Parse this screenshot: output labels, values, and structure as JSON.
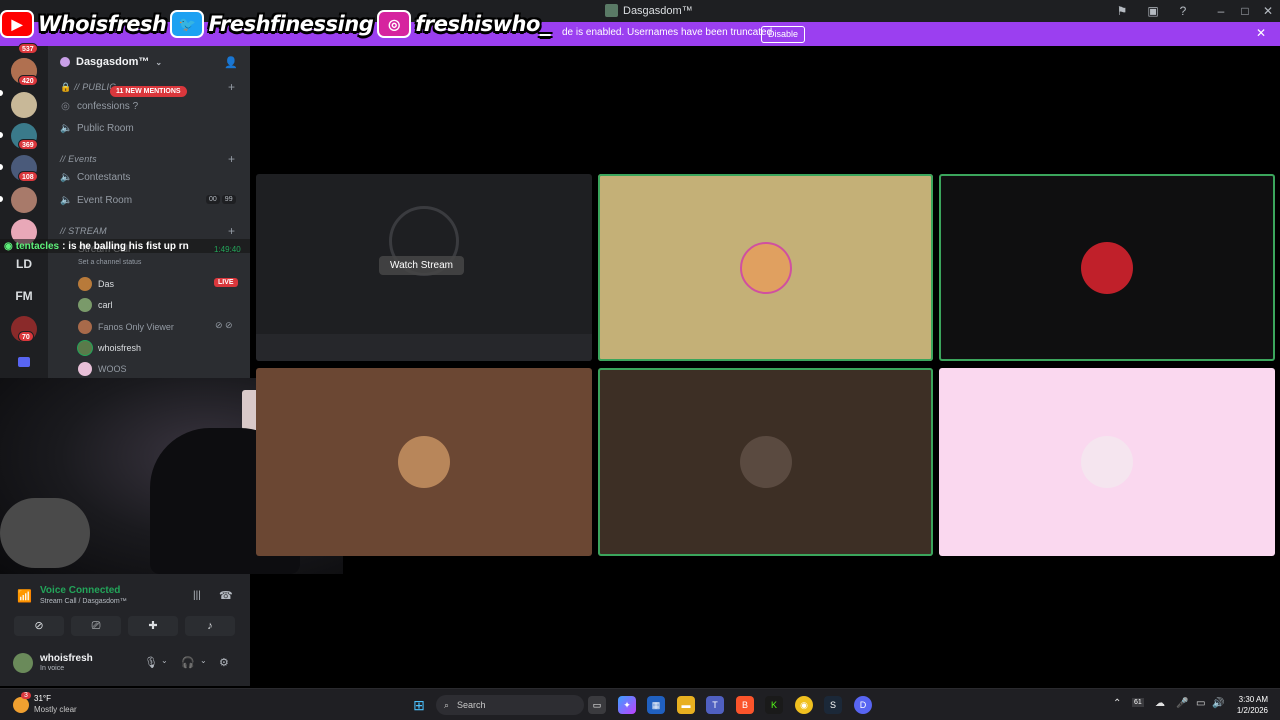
{
  "window": {
    "title": "Dasgasdom™"
  },
  "banner": {
    "message": "de is enabled. Usernames have been truncated.",
    "disable_label": "Disable"
  },
  "social": [
    {
      "platform": "youtube",
      "handle": "Whoisfresh",
      "color": "#ff0000",
      "glyph": "▶"
    },
    {
      "platform": "twitter",
      "handle": "Freshfinessing",
      "color": "#1da1f2",
      "glyph": "t"
    },
    {
      "platform": "instagram",
      "handle": "freshiswho_",
      "color": "#d6249f",
      "glyph": "◎"
    }
  ],
  "rail": {
    "badges": [
      "537",
      "420",
      "369",
      "108",
      "70"
    ],
    "text_servers": [
      "LD",
      "FM"
    ]
  },
  "server": {
    "name": "Dasgasdom™"
  },
  "mentions_pill": "11 NEW MENTIONS",
  "categories": {
    "public": "// PUBLIC",
    "events": "// Events",
    "stream": "// STREAM"
  },
  "channels": {
    "confessions": "confessions ?",
    "public_room": "Public Room",
    "contestants": "Contestants",
    "event_room": "Event Room",
    "stream_call": "Stream Call",
    "channel_status": "Set a channel status",
    "event_counter": [
      "00",
      "99"
    ]
  },
  "chat": {
    "nick": "tentacles",
    "text": ": is he balling his fist up rn",
    "timer": "1:49:40"
  },
  "voice_users": [
    {
      "name": "Das",
      "live": "LIVE",
      "color": "#b87a3a"
    },
    {
      "name": "carl",
      "color": "#7a9a6a"
    },
    {
      "name": "Fanos Only Viewer",
      "color": "#a86a4a"
    },
    {
      "name": "whoisfresh",
      "color": "#5a7a4a"
    },
    {
      "name": "WOOS",
      "color": "#e8c0d8"
    }
  ],
  "voice": {
    "title": "Voice Connected",
    "subtitle": "Stream Call / Dasgasdom™"
  },
  "me": {
    "name": "whoisfresh",
    "status": "In voice"
  },
  "stage": {
    "watch_label": "Watch Stream"
  },
  "taskbar": {
    "temp": "31°F",
    "weather": "Mostly clear",
    "weather_badge": "3",
    "search_placeholder": "Search",
    "time": "3:30 AM",
    "date": "1/2/2026",
    "tray_badge": "61"
  },
  "colors": {
    "discord_bg": "#000000",
    "sidebar": "#2b2d31",
    "accent_purple": "#9b3ff0",
    "voice_green": "#23a55a",
    "mention_red": "#da373c"
  }
}
